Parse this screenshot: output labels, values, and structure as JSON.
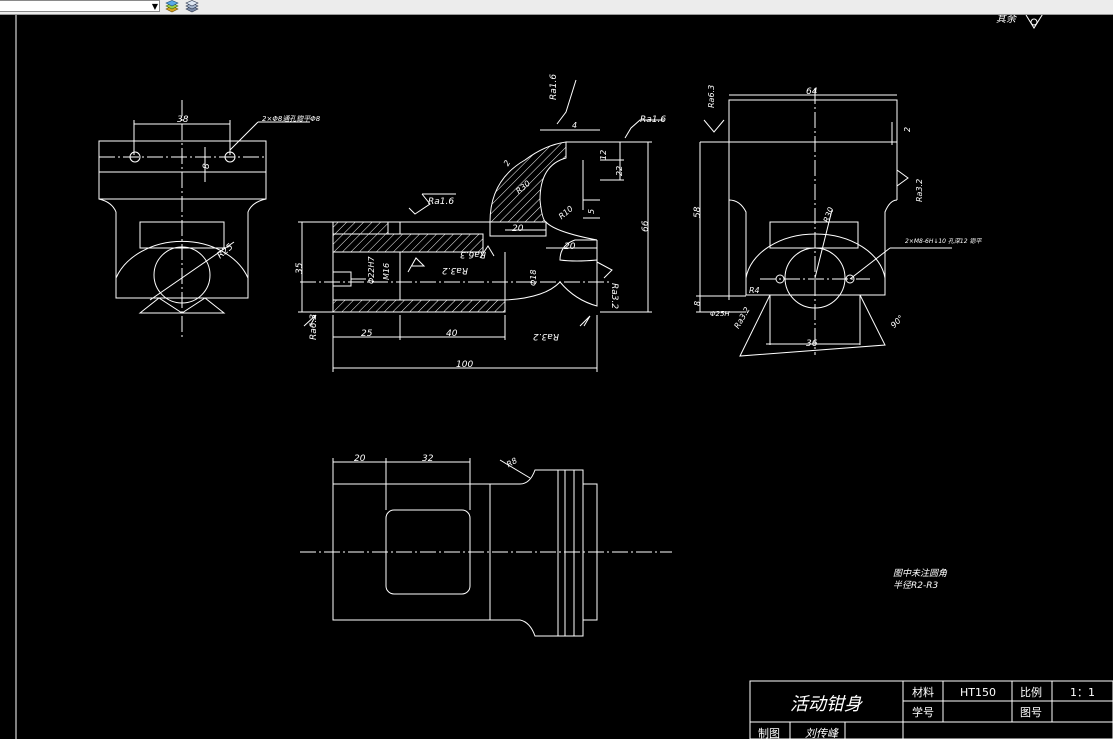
{
  "toolbar": {
    "layer_value": "",
    "icons": [
      "layer-states-icon",
      "layer-properties-icon"
    ]
  },
  "drawing": {
    "top_right_label": "其余",
    "view1": {
      "dim_width": "38",
      "dim_spacing": "8",
      "hole_note": "2×Φ8通孔锪平Φ8",
      "radius": "R25"
    },
    "view2": {
      "roughness_a": "Ra1.6",
      "roughness_b": "Ra1.6",
      "roughness_c": "Ra1.6",
      "roughness_d": "Ra3.2",
      "roughness_e": "Ra3.2",
      "roughness_f": "Ra3.2",
      "roughness_g": "Ra6.3",
      "roughness_h": "Ra6.3",
      "dim_height_left": "35",
      "dim_hole": "Φ22H7",
      "dim_m": "M16",
      "dim_25": "25",
      "dim_40": "40",
      "dim_100": "100",
      "dim_20a": "20",
      "dim_20b": "20",
      "dim_18": "Φ18",
      "dim_r30": "R30",
      "dim_r10": "R10",
      "dim_2": "2",
      "dim_4": "4",
      "dim_12": "12",
      "dim_22": "22",
      "dim_5": "5",
      "dim_66": "66"
    },
    "view3": {
      "dim_64": "64",
      "dim_2": "2",
      "dim_58": "58",
      "dim_r30": "R30",
      "dim_8": "8",
      "dim_36": "36",
      "dim_r4": "R4",
      "dim_slot": "Φ25H",
      "roughness": "Ra6.3",
      "roughness_b": "Ra3.2",
      "roughness_c": "Ra3.2",
      "note": "2×M8-6H↓10 孔深12 锪平",
      "angle": "90°"
    },
    "view4": {
      "dim_20": "20",
      "dim_32": "32",
      "dim_r": "R8"
    },
    "note_line1": "图中未注圆角",
    "note_line2": "半径R2-R3"
  },
  "title_block": {
    "part_name": "活动钳身",
    "material_label": "材料",
    "material_value": "HT150",
    "scale_label": "比例",
    "scale_value": "1：1",
    "student_id_label": "学号",
    "drawing_no_label": "图号",
    "drafter_label": "制图",
    "drafter_name": "刘传峰"
  },
  "colors": {
    "background": "#000000",
    "lines": "#ffffff",
    "toolbar": "#ececec"
  }
}
